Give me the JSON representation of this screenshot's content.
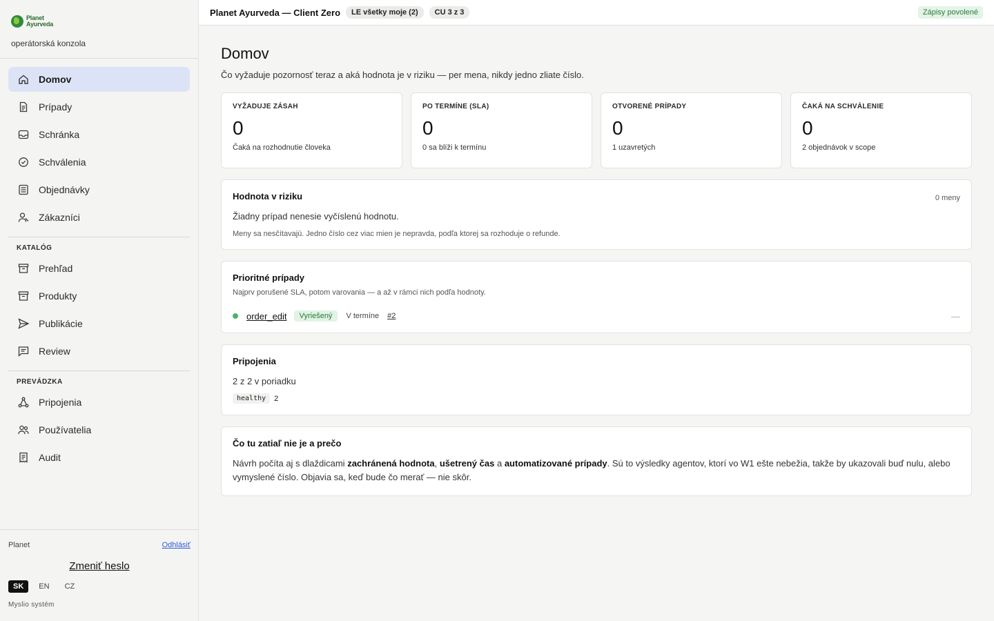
{
  "brand": {
    "logo_line1": "Planet",
    "logo_line2": "Ayurveda",
    "subtitle": "operátorská konzola"
  },
  "nav": {
    "main": [
      {
        "label": "Domov",
        "icon": "home-icon",
        "active": true
      },
      {
        "label": "Prípady",
        "icon": "document-icon"
      },
      {
        "label": "Schránka",
        "icon": "inbox-icon"
      },
      {
        "label": "Schválenia",
        "icon": "check-badge-icon"
      },
      {
        "label": "Objednávky",
        "icon": "list-icon"
      },
      {
        "label": "Zákazníci",
        "icon": "user-icon"
      }
    ],
    "catalog_title": "KATALÓG",
    "catalog": [
      {
        "label": "Prehľad",
        "icon": "archive-icon"
      },
      {
        "label": "Produkty",
        "icon": "archive-icon"
      },
      {
        "label": "Publikácie",
        "icon": "send-icon"
      },
      {
        "label": "Review",
        "icon": "chat-icon"
      }
    ],
    "ops_title": "PREVÁDZKA",
    "ops": [
      {
        "label": "Pripojenia",
        "icon": "network-icon"
      },
      {
        "label": "Používatelia",
        "icon": "users-icon"
      },
      {
        "label": "Audit",
        "icon": "receipt-icon"
      }
    ]
  },
  "footer": {
    "user": "Planet",
    "logout": "Odhlásiť",
    "change_password": "Zmeniť heslo",
    "langs": [
      "SK",
      "EN",
      "CZ"
    ],
    "active_lang": "SK",
    "made_by": "Myslio systém"
  },
  "topbar": {
    "title": "Planet Ayurveda — Client Zero",
    "pill_le": "LE všetky moje (2)",
    "pill_cu": "CU 3 z 3",
    "write_status": "Zápisy povolené"
  },
  "page": {
    "title": "Domov",
    "subtitle": "Čo vyžaduje pozornosť teraz a aká hodnota je v riziku — per mena, nikdy jedno zliate číslo."
  },
  "kpis": [
    {
      "label": "VYŽADUJE ZÁSAH",
      "value": "0",
      "note": "Čaká na rozhodnutie človeka"
    },
    {
      "label": "PO TERMÍNE (SLA)",
      "value": "0",
      "note": "0 sa blíži k termínu"
    },
    {
      "label": "OTVORENÉ PRÍPADY",
      "value": "0",
      "note": "1 uzavretých"
    },
    {
      "label": "ČAKÁ NA SCHVÁLENIE",
      "value": "0",
      "note": "2 objednávok v scope"
    }
  ],
  "risk": {
    "title": "Hodnota v riziku",
    "meta": "0 meny",
    "text": "Žiadny prípad nenesie vyčíslenú hodnotu.",
    "note": "Meny sa nesčítavajú. Jedno číslo cez viac mien je nepravda, podľa ktorej sa rozhoduje o refunde."
  },
  "priority": {
    "title": "Prioritné prípady",
    "subtitle": "Najprv porušené SLA, potom varovania — a až v rámci nich podľa hodnoty.",
    "case": {
      "name": "order_edit",
      "status": "Vyriešený",
      "sla": "V termíne",
      "number": "#2",
      "value": "—"
    }
  },
  "connections": {
    "title": "Pripojenia",
    "summary": "2 z 2 v poriadku",
    "tag": "healthy",
    "count": "2"
  },
  "missing": {
    "title": "Čo tu zatiaľ nie je a prečo",
    "p1": "Návrh počíta aj s dlaždicami ",
    "b1": "zachránená hodnota",
    "p2": ", ",
    "b2": "ušetrený čas",
    "p3": " a ",
    "b3": "automatizované prípady",
    "p4": ". Sú to výsledky agentov, ktorí vo W1 ešte nebežia, takže by ukazovali buď nulu, alebo vymyslené číslo. Objavia sa, keď bude čo merať — nie skôr."
  },
  "colors": {
    "active_nav": "#dde3f6",
    "success": "#2a7a3b",
    "success_bg": "#e1f3e4",
    "link": "#2f5bd8"
  }
}
